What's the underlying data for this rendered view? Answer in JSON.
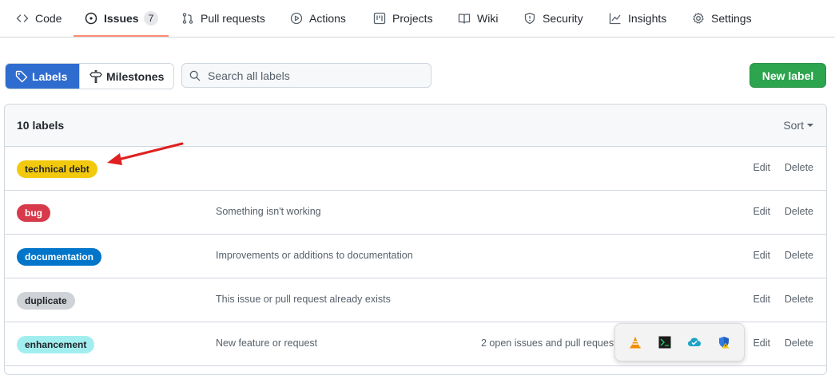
{
  "tabs": [
    {
      "label": "Code",
      "icon": "code-icon"
    },
    {
      "label": "Issues",
      "icon": "issue-opened-icon",
      "count": "7"
    },
    {
      "label": "Pull requests",
      "icon": "pull-request-icon"
    },
    {
      "label": "Actions",
      "icon": "play-icon"
    },
    {
      "label": "Projects",
      "icon": "project-icon"
    },
    {
      "label": "Wiki",
      "icon": "book-icon"
    },
    {
      "label": "Security",
      "icon": "shield-icon"
    },
    {
      "label": "Insights",
      "icon": "graph-icon"
    },
    {
      "label": "Settings",
      "icon": "gear-icon"
    }
  ],
  "subnav": {
    "labels": "Labels",
    "milestones": "Milestones",
    "search_placeholder": "Search all labels",
    "new_label": "New label"
  },
  "labels_box": {
    "count_text": "10 labels",
    "sort": "Sort",
    "edit": "Edit",
    "delete": "Delete",
    "rows": [
      {
        "name": "technical debt",
        "description": "",
        "issues": "",
        "bg": "#f2c90c",
        "fg": "#1f2328"
      },
      {
        "name": "bug",
        "description": "Something isn't working",
        "issues": "",
        "bg": "#d73a4a",
        "fg": "#ffffff"
      },
      {
        "name": "documentation",
        "description": "Improvements or additions to documentation",
        "issues": "",
        "bg": "#0075ca",
        "fg": "#ffffff"
      },
      {
        "name": "duplicate",
        "description": "This issue or pull request already exists",
        "issues": "",
        "bg": "#cfd3d7",
        "fg": "#1f2328"
      },
      {
        "name": "enhancement",
        "description": "New feature or request",
        "issues": "2 open issues and pull request",
        "bg": "#a2eeef",
        "fg": "#1f2328"
      }
    ]
  },
  "tray": {
    "icons": [
      "vlc-cone-icon",
      "terminal-icon",
      "cloud-check-icon",
      "shield-warning-icon"
    ]
  },
  "colors": {
    "accent_blue": "#2f6ccf",
    "primary_green": "#2da44e",
    "tab_underline": "#fd8c73",
    "annotation_arrow": "#e02020"
  }
}
